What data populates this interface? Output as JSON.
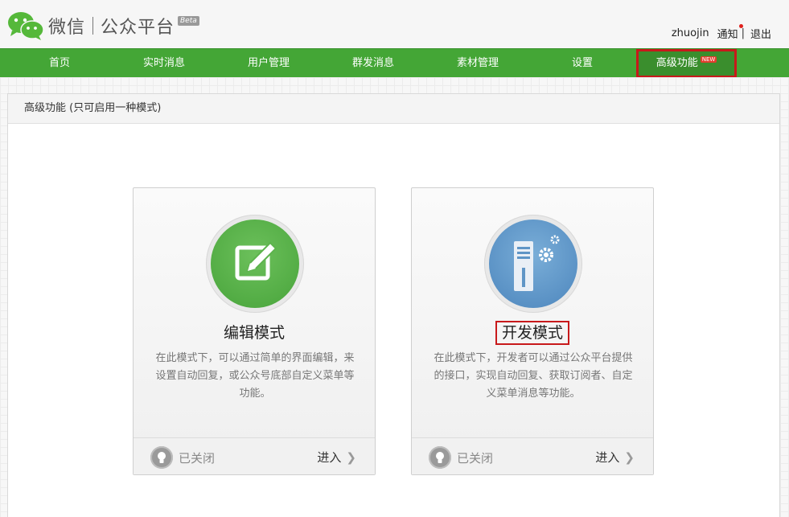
{
  "brand": {
    "name": "微信",
    "product": "公众平台",
    "beta": "Beta"
  },
  "user": {
    "username": "zhuojin",
    "notify": "通知",
    "separator": "|",
    "logout": "退出"
  },
  "nav": {
    "items": [
      {
        "label": "首页"
      },
      {
        "label": "实时消息"
      },
      {
        "label": "用户管理"
      },
      {
        "label": "群发消息"
      },
      {
        "label": "素材管理"
      },
      {
        "label": "设置"
      },
      {
        "label": "高级功能",
        "badge": "NEW"
      }
    ],
    "active_index": 6
  },
  "panel": {
    "title": "高级功能 (只可启用一种模式)"
  },
  "cards": [
    {
      "title": "编辑模式",
      "icon": "edit-icon",
      "description": "在此模式下，可以通过简单的界面编辑，来设置自动回复，或公众号底部自定义菜单等功能。",
      "status": "已关闭",
      "enter": "进入"
    },
    {
      "title": "开发模式",
      "icon": "server-gear-icon",
      "description": "在此模式下，开发者可以通过公众平台提供的接口，实现自动回复、获取订阅者、自定义菜单消息等功能。",
      "status": "已关闭",
      "enter": "进入"
    }
  ],
  "colors": {
    "nav_green": "#44a636",
    "highlight_red": "#c8191b",
    "edit_circle": "#5cb34c",
    "dev_circle": "#5f95c6"
  }
}
